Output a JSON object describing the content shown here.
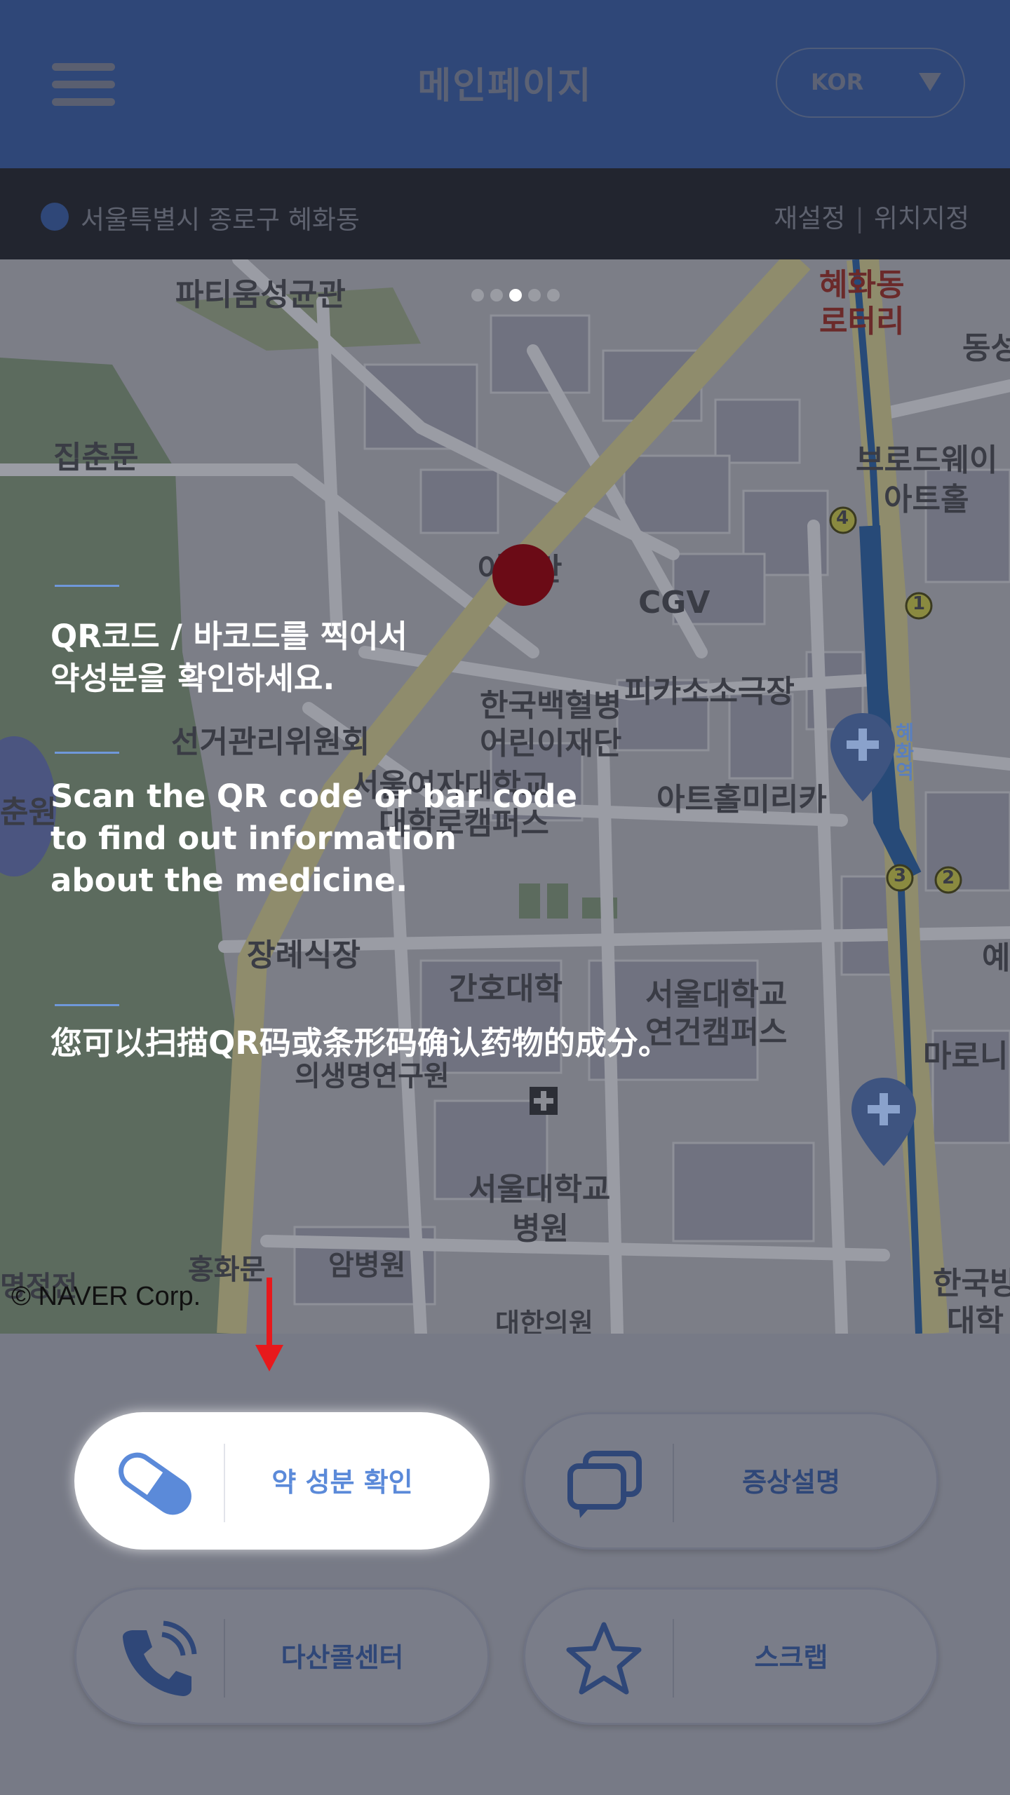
{
  "header": {
    "title": "메인페이지",
    "language": "KOR"
  },
  "location": {
    "address": "서울특별시 종로구 혜화동",
    "reset_label": "재설정",
    "separator": "|",
    "set_label": "위치지정"
  },
  "pager": {
    "total": 5,
    "active_index": 2
  },
  "intro": {
    "korean": "QR코드 / 바코드를 찍어서\n약성분을 확인하세요.",
    "english": "Scan the QR code or bar code\nto find out information\nabout the medicine.",
    "chinese": "您可以扫描QR码或条形码确认药物的成分。"
  },
  "map": {
    "attribution": "© NAVER Corp.",
    "labels": [
      "파티움성균관",
      "혜화동",
      "로터리",
      "동성",
      "집춘문",
      "브로드웨이",
      "아트홀",
      "이스탄",
      "CGV",
      "피카소소극장",
      "한국백혈병",
      "어린이재단",
      "선거관리위원회",
      "서울여자대학교",
      "대학로캠퍼스",
      "아트홀미리카",
      "춘원",
      "장례식장",
      "간호대학",
      "서울대학교",
      "연건캠퍼스",
      "의생명연구원",
      "마로니",
      "서울대학교",
      "병원",
      "홍화문",
      "암병원",
      "명정전",
      "대한의원",
      "한국방",
      "대학",
      "예",
      "4",
      "1",
      "3",
      "2",
      "혜화역"
    ]
  },
  "buttons": [
    {
      "label": "약 성분 확인",
      "icon": "pill-icon",
      "active": true
    },
    {
      "label": "증상설명",
      "icon": "chat-bubbles-icon",
      "active": false
    },
    {
      "label": "다산콜센터",
      "icon": "phone-icon",
      "active": false
    },
    {
      "label": "스크랩",
      "icon": "star-icon",
      "active": false
    }
  ],
  "colors": {
    "header": "#2f4778",
    "location_bar": "#22252f",
    "accent": "#6f98da",
    "active_label": "#5b8ad9",
    "arrow": "#e8191c",
    "marker": "#6b0b16"
  }
}
